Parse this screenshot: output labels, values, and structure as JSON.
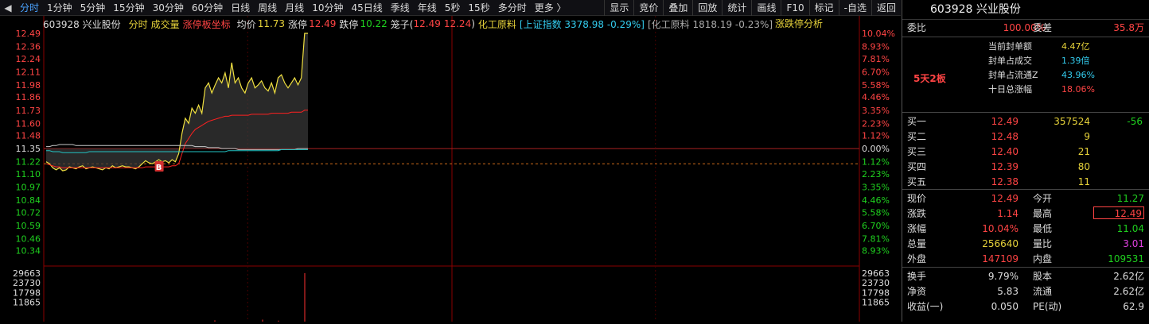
{
  "toolbar": {
    "timeframes": [
      "分时",
      "1分钟",
      "5分钟",
      "15分钟",
      "30分钟",
      "60分钟",
      "日线",
      "周线",
      "月线",
      "10分钟",
      "45日线",
      "季线",
      "年线",
      "5秒",
      "15秒",
      "多分时",
      "更多 〉"
    ],
    "active_index": 0,
    "buttons": [
      "显示",
      "竞价",
      "叠加",
      "回放",
      "统计",
      "画线",
      "F10",
      "标记",
      "-自选",
      "返回"
    ]
  },
  "infobar": {
    "code_name": "603928 兴业股份",
    "mode": "分时",
    "volume": "成交量",
    "axis_mode": "涨停板坐标",
    "avg_label": "均价",
    "avg_value": "11.73",
    "up_limit_label": "涨停",
    "up_limit_value": "12.49",
    "down_limit_label": "跌停",
    "down_limit_value": "10.22",
    "cage_label": "笼子(",
    "cage_high": "12.49",
    "cage_low": "12.24",
    "cage_close": ")",
    "sector": "化工原料",
    "index_block": "[上证指数 3378.98 -0.29%]",
    "sector_block": "[化工原料 1818.19 -0.23%]",
    "analysis": "涨跌停分析"
  },
  "chart_data": {
    "type": "line",
    "prev_close": 11.35,
    "ylim": [
      10.22,
      12.49
    ],
    "price_ticks": [
      "12.49",
      "12.36",
      "12.24",
      "12.11",
      "11.98",
      "11.86",
      "11.73",
      "11.60",
      "11.48",
      "11.35",
      "11.22",
      "11.10",
      "10.97",
      "10.84",
      "10.72",
      "10.59",
      "10.46",
      "10.34"
    ],
    "pct_ticks": [
      "10.04%",
      "8.93%",
      "7.81%",
      "6.70%",
      "5.58%",
      "4.46%",
      "3.35%",
      "2.23%",
      "1.12%",
      "0.00%",
      "1.12%",
      "2.23%",
      "3.35%",
      "4.46%",
      "5.58%",
      "6.70%",
      "7.81%",
      "8.93%"
    ],
    "volume_ticks": [
      "29663",
      "23730",
      "17798",
      "11865"
    ],
    "series": [
      {
        "values": [
          11.22,
          11.2,
          11.16,
          11.14,
          11.16,
          11.13,
          11.14,
          11.17,
          11.16,
          11.15,
          11.17,
          11.18,
          11.15,
          11.16,
          11.17,
          11.16,
          11.15,
          11.14,
          11.16,
          11.15,
          11.18,
          11.16,
          11.17,
          11.18,
          11.17,
          11.17,
          11.16,
          11.15,
          11.17,
          11.2,
          11.23,
          11.21,
          11.2,
          11.22,
          11.24,
          11.22,
          11.23,
          11.21,
          11.24,
          11.22,
          11.3,
          11.5,
          11.65,
          11.6,
          11.75,
          11.7,
          11.78,
          11.7,
          11.95,
          12.0,
          11.9,
          11.98,
          12.05,
          12.0,
          12.1,
          11.95,
          12.2,
          12.0,
          12.05,
          11.95,
          11.9,
          12.0,
          12.05,
          11.95,
          11.98,
          12.02,
          11.95,
          11.92,
          12.0,
          11.9,
          12.05,
          12.08,
          12.0,
          11.95,
          12.0,
          12.05,
          11.98,
          12.05,
          12.49,
          12.49
        ]
      },
      {
        "values": [
          11.2,
          11.19,
          11.18,
          11.17,
          11.17,
          11.16,
          11.16,
          11.16,
          11.16,
          11.16,
          11.16,
          11.16,
          11.16,
          11.16,
          11.16,
          11.16,
          11.16,
          11.16,
          11.16,
          11.16,
          11.16,
          11.16,
          11.16,
          11.16,
          11.16,
          11.16,
          11.16,
          11.16,
          11.16,
          11.16,
          11.17,
          11.17,
          11.17,
          11.17,
          11.17,
          11.17,
          11.17,
          11.17,
          11.18,
          11.18,
          11.2,
          11.3,
          11.4,
          11.45,
          11.5,
          11.54,
          11.56,
          11.58,
          11.6,
          11.62,
          11.63,
          11.64,
          11.65,
          11.66,
          11.67,
          11.67,
          11.68,
          11.68,
          11.68,
          11.68,
          11.68,
          11.68,
          11.69,
          11.69,
          11.69,
          11.69,
          11.69,
          11.69,
          11.7,
          11.7,
          11.7,
          11.7,
          11.7,
          11.7,
          11.71,
          11.71,
          11.71,
          11.71,
          11.73,
          11.73
        ]
      },
      {
        "values": [
          11.37,
          11.37,
          11.38,
          11.38,
          11.39,
          11.39,
          11.39,
          11.39,
          11.39,
          11.38,
          11.38,
          11.38,
          11.38,
          11.38,
          11.38,
          11.38,
          11.38,
          11.38,
          11.38,
          11.38,
          11.38,
          11.38,
          11.38,
          11.38,
          11.38,
          11.38,
          11.38,
          11.38,
          11.38,
          11.38,
          11.38,
          11.38,
          11.38,
          11.38,
          11.38,
          11.38,
          11.38,
          11.38,
          11.38,
          11.38,
          11.38,
          11.38,
          11.38,
          11.38,
          11.38,
          11.37,
          11.37,
          11.37,
          11.37,
          11.36,
          11.36,
          11.36,
          11.36,
          11.35,
          11.35,
          11.35,
          11.35,
          11.35,
          11.34,
          11.34,
          11.34,
          11.34,
          11.34,
          11.34,
          11.34,
          11.34,
          11.34,
          11.34,
          11.34,
          11.34,
          11.34,
          11.34,
          11.34,
          11.34,
          11.34,
          11.34,
          11.35,
          11.35,
          11.35,
          11.35
        ]
      },
      {
        "values": [
          11.33,
          11.33,
          11.32,
          11.32,
          11.32,
          11.31,
          11.31,
          11.31,
          11.31,
          11.31,
          11.31,
          11.31,
          11.31,
          11.32,
          11.32,
          11.32,
          11.32,
          11.32,
          11.32,
          11.32,
          11.32,
          11.32,
          11.32,
          11.32,
          11.32,
          11.32,
          11.32,
          11.32,
          11.32,
          11.32,
          11.32,
          11.32,
          11.32,
          11.32,
          11.32,
          11.32,
          11.32,
          11.32,
          11.32,
          11.32,
          11.32,
          11.32,
          11.32,
          11.32,
          11.32,
          11.32,
          11.32,
          11.32,
          11.32,
          11.32,
          11.32,
          11.32,
          11.32,
          11.32,
          11.32,
          11.33,
          11.33,
          11.33,
          11.33,
          11.33,
          11.33,
          11.33,
          11.33,
          11.33,
          11.33,
          11.33,
          11.33,
          11.33,
          11.33,
          11.33,
          11.33,
          11.34,
          11.34,
          11.34,
          11.34,
          11.34,
          11.34,
          11.34,
          11.34,
          11.34
        ]
      }
    ],
    "volume_bars": [
      [
        270,
        800
      ],
      [
        330,
        1200
      ],
      [
        350,
        600
      ],
      [
        383,
        29663
      ]
    ],
    "buy_marker": "B",
    "marker_index": 34
  },
  "panel": {
    "title": "603928 兴业股份",
    "weibi_label": "委比",
    "weibi_value": "100.00%",
    "weicha_label": "委差",
    "weicha_value": "35.8万",
    "seal_items": [
      {
        "label": "当前封单额",
        "value": "4.47亿",
        "color": "yellow"
      },
      {
        "label": "封单占成交",
        "value": "1.39倍",
        "color": "cyan"
      },
      {
        "label": "封单占流通Z",
        "value": "43.96%",
        "color": "cyan"
      },
      {
        "label": "十日总涨幅",
        "value": "18.06%",
        "color": "red"
      }
    ],
    "streak": "5天2板",
    "bids": [
      {
        "label": "买一",
        "price": "12.49",
        "volume": "357524",
        "change": "-56"
      },
      {
        "label": "买二",
        "price": "12.48",
        "volume": "9",
        "change": ""
      },
      {
        "label": "买三",
        "price": "12.40",
        "volume": "21",
        "change": ""
      },
      {
        "label": "买四",
        "price": "12.39",
        "volume": "80",
        "change": ""
      },
      {
        "label": "买五",
        "price": "12.38",
        "volume": "11",
        "change": ""
      }
    ],
    "quote_rows": [
      {
        "l1": "现价",
        "v1": "12.49",
        "c1": "red",
        "l2": "今开",
        "v2": "11.27",
        "c2": "green"
      },
      {
        "l1": "涨跌",
        "v1": "1.14",
        "c1": "red",
        "l2": "最高",
        "v2": "12.49",
        "c2": "red"
      },
      {
        "l1": "涨幅",
        "v1": "10.04%",
        "c1": "red",
        "l2": "最低",
        "v2": "11.04",
        "c2": "green"
      },
      {
        "l1": "总量",
        "v1": "256640",
        "c1": "yellow",
        "l2": "量比",
        "v2": "3.01",
        "c2": "magenta"
      },
      {
        "l1": "外盘",
        "v1": "147109",
        "c1": "red",
        "l2": "内盘",
        "v2": "109531",
        "c2": "green"
      }
    ],
    "stock_rows": [
      {
        "l1": "换手",
        "v1": "9.79%",
        "l2": "股本",
        "v2": "2.62亿"
      },
      {
        "l1": "净资",
        "v1": "5.83",
        "l2": "流通",
        "v2": "2.62亿"
      },
      {
        "l1": "收益(一)",
        "v1": "0.050",
        "l2": "PE(动)",
        "v2": "62.9"
      }
    ]
  }
}
